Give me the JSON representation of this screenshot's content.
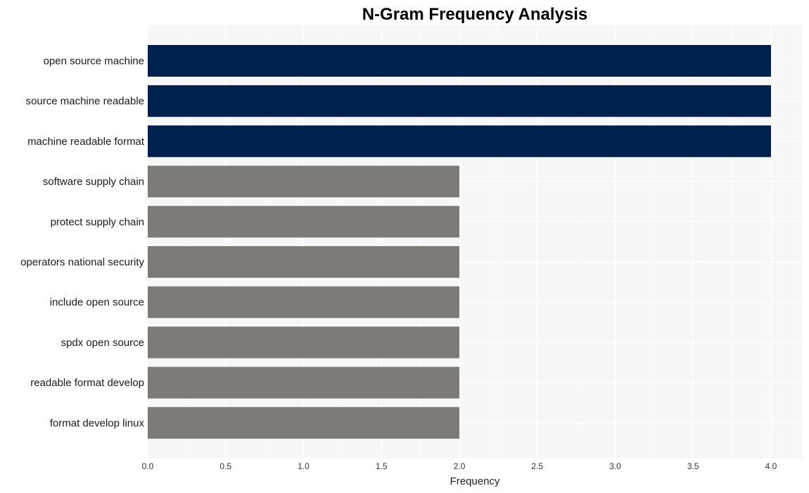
{
  "chart_data": {
    "type": "bar",
    "orientation": "horizontal",
    "title": "N-Gram Frequency Analysis",
    "xlabel": "Frequency",
    "ylabel": "",
    "xlim": [
      0,
      4.2
    ],
    "xticks": [
      "0.0",
      "0.5",
      "1.0",
      "1.5",
      "2.0",
      "2.5",
      "3.0",
      "3.5",
      "4.0"
    ],
    "xtick_values": [
      0,
      0.5,
      1.0,
      1.5,
      2.0,
      2.5,
      3.0,
      3.5,
      4.0
    ],
    "grid": true,
    "legend": "none",
    "categories": [
      "open source machine",
      "source machine readable",
      "machine readable format",
      "software supply chain",
      "protect supply chain",
      "operators national security",
      "include open source",
      "spdx open source",
      "readable format develop",
      "format develop linux"
    ],
    "values": [
      4,
      4,
      4,
      2,
      2,
      2,
      2,
      2,
      2,
      2
    ],
    "colors": {
      "highlight": "#00214d",
      "default": "#7c7b77",
      "panel_bg": "#f7f7f7",
      "grid": "#ffffff"
    }
  }
}
